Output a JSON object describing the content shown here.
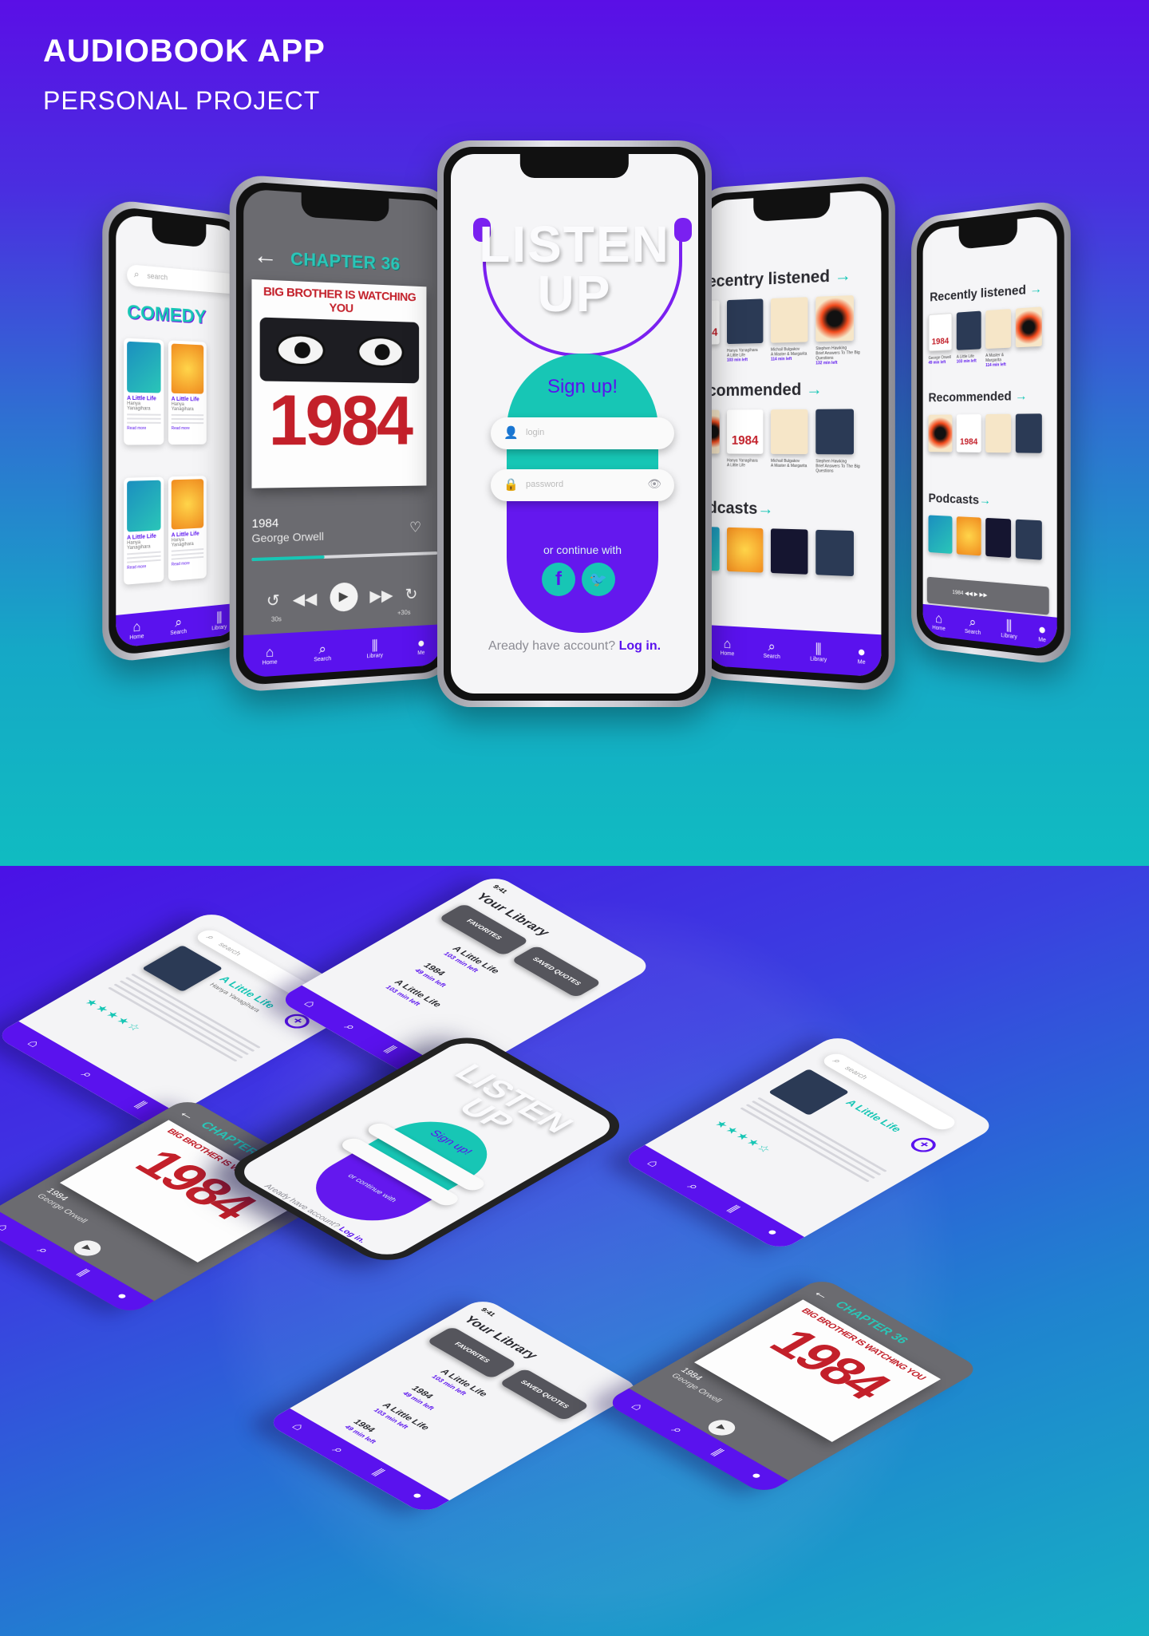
{
  "header": {
    "title": "AUDIOBOOK APP",
    "subtitle": "PERSONAL PROJECT"
  },
  "colors": {
    "accent": "#5a12ee",
    "teal": "#17c6b5",
    "cover_red": "#c3202a"
  },
  "login": {
    "logo_line1": "LISTEN",
    "logo_line2": "UP",
    "signup": "Sign up!",
    "login_placeholder": "login",
    "password_placeholder": "password",
    "or_continue": "or continue with",
    "facebook_glyph": "f",
    "twitter_glyph": "🐦",
    "already": "Aready have account?",
    "login_link": "Log in."
  },
  "player": {
    "chapter": "CHAPTER 36",
    "cover_banner": "BIG BROTHER IS WATCHING YOU",
    "cover_number": "1984",
    "title": "1984",
    "author": "George Orwell",
    "progress": 0.38,
    "time_left": "30s",
    "time_right": "+30s"
  },
  "comedy": {
    "search_placeholder": "search",
    "section": "COMEDY",
    "books": [
      {
        "title": "A Little Life",
        "author": "Hanya Yanagihara",
        "read_more": "Read more"
      },
      {
        "title": "A Little Life",
        "author": "Hanya Yanagihara",
        "read_more": "Read more"
      },
      {
        "title": "A Little Life",
        "author": "Hanya Yanagihara",
        "read_more": "Read more"
      },
      {
        "title": "A Little Life",
        "author": "Hanya Yanagihara",
        "read_more": "Read more"
      }
    ]
  },
  "home": {
    "recently": "Recently listened",
    "recently_cut": "ecentry listened",
    "recommended": "Recommended",
    "recommended_cut": "commended",
    "podcasts": "Podcasts",
    "podcasts_cut": "dcasts",
    "books": [
      {
        "title": "1984",
        "author": "George Orwell",
        "left": "49 min left"
      },
      {
        "title": "A Little Life",
        "author": "Hanya Yanagihara",
        "left": "103 min left"
      },
      {
        "title": "A Master & Margarita",
        "author": "Michail Bulgakov",
        "left": "114 min left"
      },
      {
        "title": "Brief Answers To The Big Questions",
        "author": "Stephen Hawking",
        "left": "132 min left"
      }
    ],
    "mini_player": {
      "title": "1984",
      "author": "George Orwell"
    }
  },
  "detail": {
    "title": "A Little Life",
    "author": "Hanya Yanagihara",
    "stars": "★★★★☆",
    "search_placeholder": "search"
  },
  "library": {
    "title": "Your Library",
    "time": "9:41",
    "favorites": "FAVORITES",
    "saved": "SAVED QUOTES",
    "items": [
      {
        "title": "A Little Life",
        "left": "103 min left"
      },
      {
        "title": "1984",
        "left": "49 min left"
      },
      {
        "title": "A Little Life",
        "left": "103 min left"
      },
      {
        "title": "1984",
        "left": "49 min left"
      }
    ]
  },
  "nav": {
    "home": "Home",
    "search": "Search",
    "library": "Library",
    "me": "Me"
  }
}
